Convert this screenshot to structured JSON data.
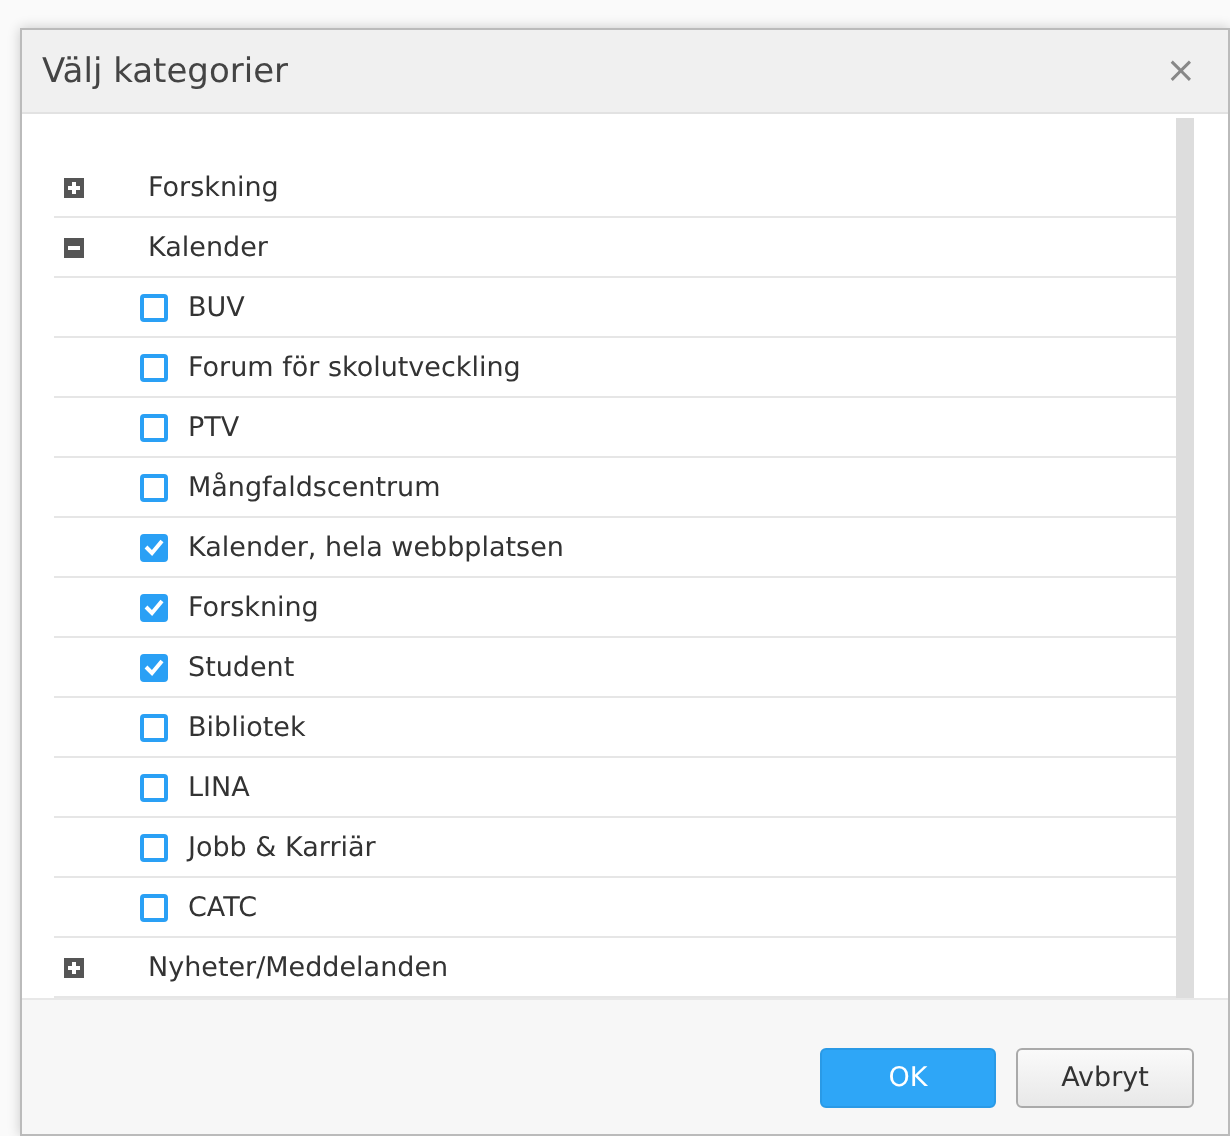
{
  "dialog": {
    "title": "Välj kategorier",
    "close": "×",
    "tree": [
      {
        "label": "Forskning",
        "expanded": false
      },
      {
        "label": "Kalender",
        "expanded": true,
        "children": [
          {
            "label": "BUV",
            "checked": false
          },
          {
            "label": "Forum för skolutveckling",
            "checked": false
          },
          {
            "label": "PTV",
            "checked": false
          },
          {
            "label": "Mångfaldscentrum",
            "checked": false
          },
          {
            "label": "Kalender, hela webbplatsen",
            "checked": true
          },
          {
            "label": "Forskning",
            "checked": true
          },
          {
            "label": "Student",
            "checked": true
          },
          {
            "label": "Bibliotek",
            "checked": false
          },
          {
            "label": "LINA",
            "checked": false
          },
          {
            "label": "Jobb & Karriär",
            "checked": false
          },
          {
            "label": "CATC",
            "checked": false
          }
        ]
      },
      {
        "label": "Nyheter/Meddelanden",
        "expanded": false
      }
    ],
    "buttons": [
      {
        "label": "OK",
        "kind": "primary"
      },
      {
        "label": "Avbryt",
        "kind": "secondary"
      }
    ]
  }
}
